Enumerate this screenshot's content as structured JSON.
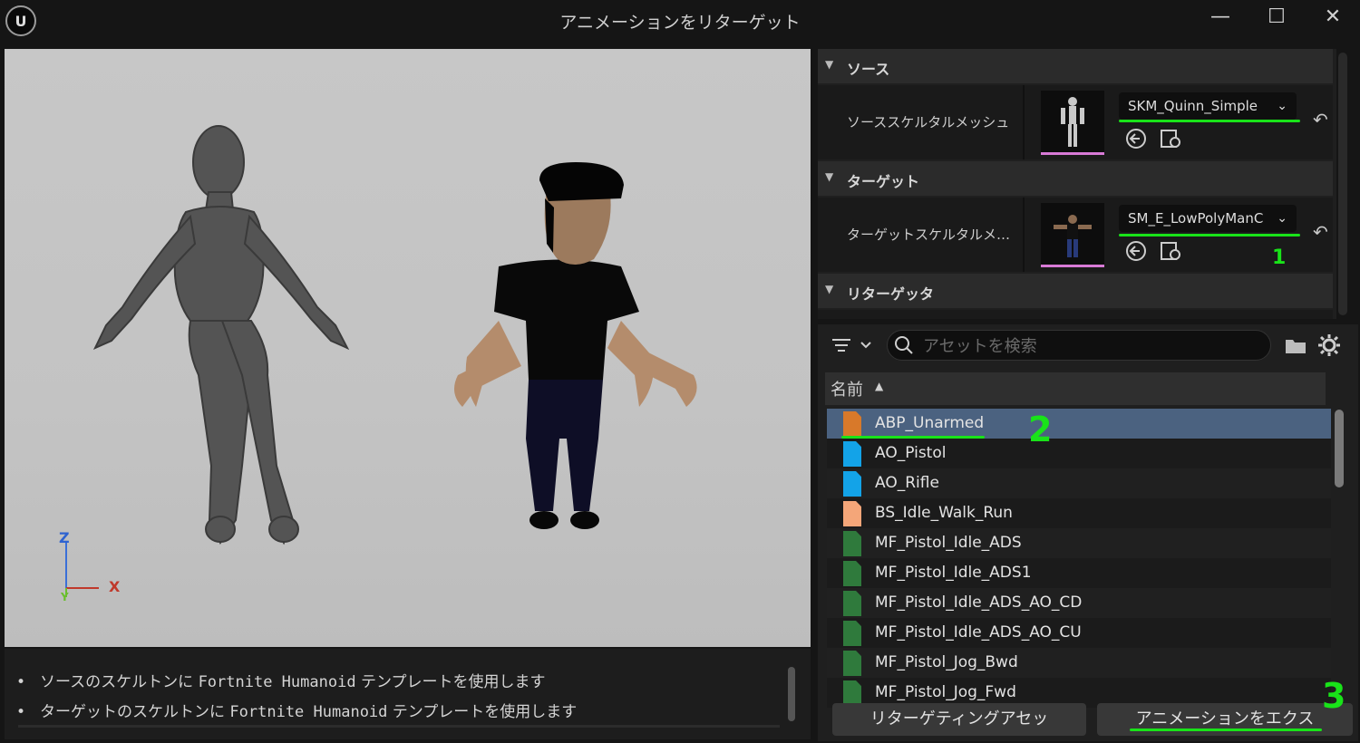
{
  "window": {
    "title": "アニメーションをリターゲット",
    "minimize": "—",
    "maximize": "☐",
    "close": "✕"
  },
  "viewport": {
    "axis_z": "Z",
    "axis_x": "X",
    "axis_y": "Y"
  },
  "log": {
    "lines": [
      {
        "pre": "ソースのスケルトンに ",
        "mono": "Fortnite Humanoid",
        "post": " テンプレートを使用します"
      },
      {
        "pre": "ターゲットのスケルトンに ",
        "mono": "Fortnite Humanoid",
        "post": " テンプレートを使用します"
      }
    ]
  },
  "details": {
    "source": {
      "category": "ソース",
      "label": "ソーススケルタルメッシュ",
      "value": "SKM_Quinn_Simple"
    },
    "target": {
      "category": "ターゲット",
      "label": "ターゲットスケルタルメッシュ",
      "value": "SM_E_LowPolyManC"
    },
    "retargeter": {
      "category": "リターゲッタ"
    }
  },
  "asset_browser": {
    "search_placeholder": "アセットを検索",
    "column_name": "名前",
    "items": [
      {
        "name": "ABP_Unarmed",
        "color": "#d8792a",
        "selected": true
      },
      {
        "name": "AO_Pistol",
        "color": "#13a3e8",
        "selected": false
      },
      {
        "name": "AO_Rifle",
        "color": "#13a3e8",
        "selected": false
      },
      {
        "name": "BS_Idle_Walk_Run",
        "color": "#f4a679",
        "selected": false
      },
      {
        "name": "MF_Pistol_Idle_ADS",
        "color": "#2f7a3c",
        "selected": false
      },
      {
        "name": "MF_Pistol_Idle_ADS1",
        "color": "#2f7a3c",
        "selected": false
      },
      {
        "name": "MF_Pistol_Idle_ADS_AO_CD",
        "color": "#2f7a3c",
        "selected": false
      },
      {
        "name": "MF_Pistol_Idle_ADS_AO_CU",
        "color": "#2f7a3c",
        "selected": false
      },
      {
        "name": "MF_Pistol_Jog_Bwd",
        "color": "#2f7a3c",
        "selected": false
      },
      {
        "name": "MF_Pistol_Jog_Fwd",
        "color": "#2f7a3c",
        "selected": false
      }
    ]
  },
  "buttons": {
    "retarget_assets": "リターゲティングアセッ",
    "export_animations": "アニメーションをエクス"
  },
  "annotations": {
    "one": "1",
    "two": "2",
    "three": "3"
  },
  "colors": {
    "highlight": "#19e319",
    "selection": "#4b6280"
  }
}
